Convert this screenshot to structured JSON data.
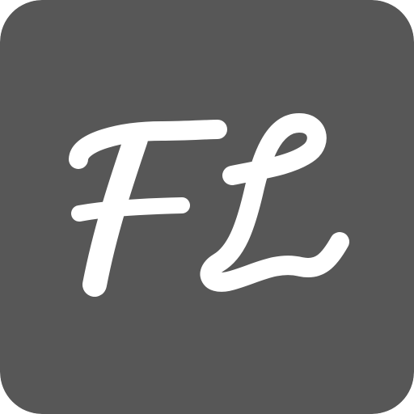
{
  "icon": {
    "monogram": "FL",
    "background_color": "#575757",
    "glyph_color": "#ffffff",
    "style": "script-monogram-logo"
  }
}
